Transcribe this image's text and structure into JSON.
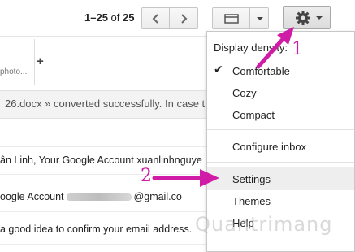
{
  "pager": {
    "range": "1–25",
    "of": "of",
    "total": "25"
  },
  "tab": {
    "label": "photo..."
  },
  "notice": {
    "text": "26.docx » converted successfully. In case th"
  },
  "rows": [
    {
      "prefix": "ân Linh, Your Google Account xuanlinhnguye",
      "suffix": ""
    },
    {
      "prefix": "oogle Account",
      "suffix": "@gmail.co"
    },
    {
      "prefix": "a good idea to confirm your email address.",
      "suffix": ""
    }
  ],
  "menu": {
    "heading": "Display density:",
    "density_options": [
      {
        "label": "Comfortable",
        "checked": true
      },
      {
        "label": "Cozy",
        "checked": false
      },
      {
        "label": "Compact",
        "checked": false
      }
    ],
    "configure": "Configure inbox",
    "settings": "Settings",
    "themes": "Themes",
    "help": "Help"
  },
  "annotations": {
    "one": "1",
    "two": "2",
    "color": "#d01ba6"
  },
  "watermark": "Quantrimang",
  "icons": [
    "chevron-left-icon",
    "chevron-right-icon",
    "density-icon",
    "caret-down-icon",
    "gear-icon",
    "plus-icon",
    "check-icon",
    "arrow-icon"
  ]
}
